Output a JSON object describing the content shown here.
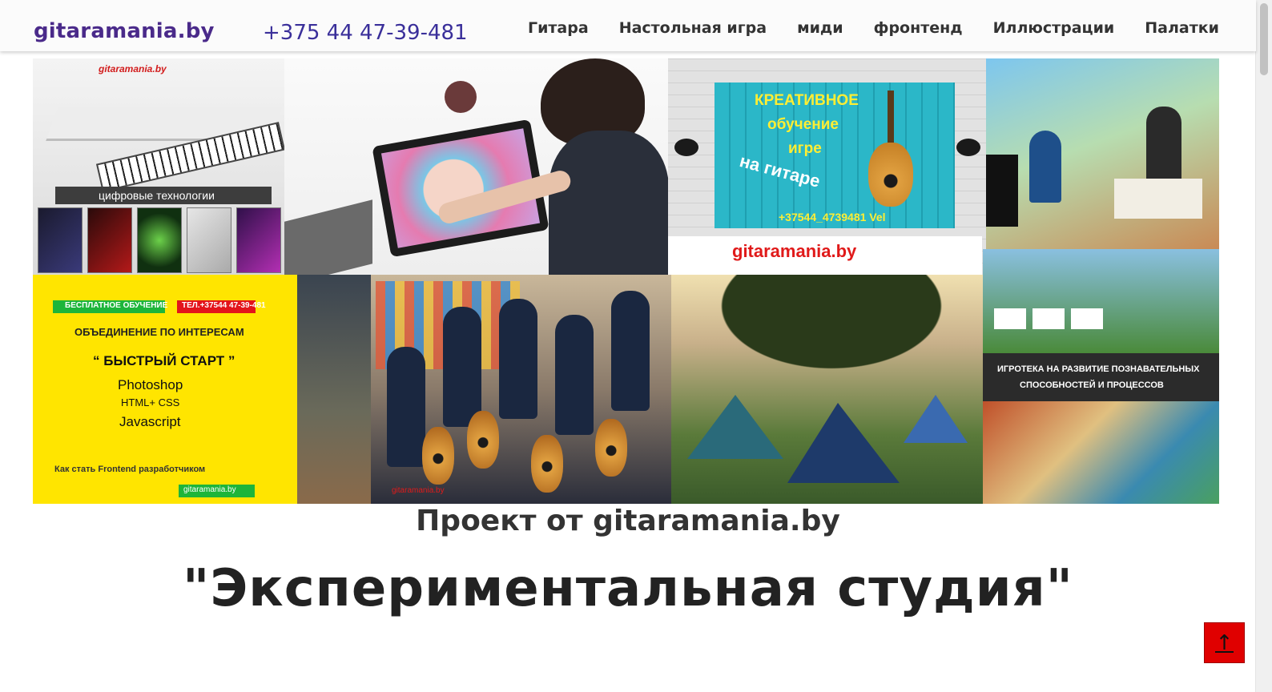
{
  "header": {
    "logo": "gitaramania.by",
    "phone": "+375 44 47-39-481",
    "nav": [
      "Гитара",
      "Настольная игра",
      "миди",
      "фронтенд",
      "Иллюстрации",
      "Палатки"
    ]
  },
  "collage": {
    "tile_digital": {
      "brand": "gitaramania.by",
      "caption": "цифровые технологии"
    },
    "tile_creative": {
      "line1": "КРЕАТИВНОЕ",
      "line2": "обучение",
      "line3": "игре",
      "line4": "на гитаре",
      "phone": "+37544_4739481 Vel",
      "site": "gitaramania.by"
    },
    "tile_course": {
      "free": "БЕСПЛАТНОЕ ОБУЧЕНИЕ",
      "tel": "ТЕЛ.+37544 47-39-481",
      "group": "ОБЪЕДИНЕНИЕ ПО ИНТЕРЕСАМ",
      "quick": "“ БЫСТРЫЙ СТАРТ ”",
      "photoshop": "Photoshop",
      "htmlcss": "HTML+ CSS",
      "js": "Javascript",
      "howto": "Как стать Frontend разработчиком",
      "site": "gitaramania.by"
    },
    "tile_group": {
      "watermark": "gitaramania.by"
    },
    "tile_games": {
      "line1": "ИГРОТЕКА НА РАЗВИТИЕ ПОЗНАВАТЕЛЬНЫХ",
      "line2": "СПОСОБНОСТЕЙ И ПРОЦЕССОВ"
    }
  },
  "main": {
    "subtitle": "Проект от gitaramania.by",
    "title": "\"Экспериментальная студия\""
  },
  "colors": {
    "logo": "#4a2a8a",
    "phone": "#3a2f9a",
    "back_to_top": "#e00000"
  },
  "icons": {
    "back_to_top": "arrow-up-icon"
  }
}
